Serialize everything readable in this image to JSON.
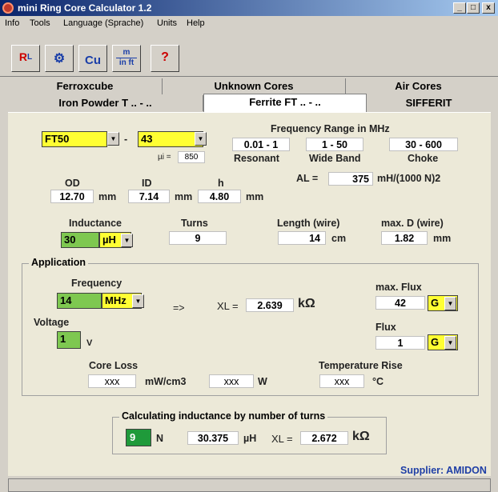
{
  "window": {
    "title": "mini Ring Core Calculator 1.2"
  },
  "menu": [
    "Info",
    "Tools",
    "Language (Sprache)",
    "Units",
    "Help"
  ],
  "toolbar": {
    "btn1": "R",
    "btn1b": "L",
    "btn2": "⚙",
    "btn3": "Cu",
    "btn4a": "m",
    "btn4b": "in ft",
    "btn5": "?"
  },
  "tabs": {
    "row1": [
      "Ferroxcube",
      "Unknown Cores",
      "Air Cores"
    ],
    "row2": [
      "Iron Powder T .. - ..",
      "Ferrite FT .. - ..",
      "SIFFERIT"
    ]
  },
  "core": {
    "type": "FT50",
    "dash": "-",
    "material": "43",
    "mu_label": "µi =",
    "mu": "850"
  },
  "freq_range": {
    "title": "Frequency Range in MHz",
    "resonant_val": "0.01 - 1",
    "wide_val": "1 - 50",
    "choke_val": "30 - 600",
    "resonant": "Resonant",
    "wide": "Wide Band",
    "choke": "Choke"
  },
  "al": {
    "label": "AL =",
    "value": "375",
    "unit": "mH/(1000 N)2"
  },
  "dims": {
    "od_label": "OD",
    "id_label": "ID",
    "h_label": "h",
    "od": "12.70",
    "id": "7.14",
    "h": "4.80",
    "unit": "mm"
  },
  "inductance": {
    "label": "Inductance",
    "value": "30",
    "unit": "µH"
  },
  "turns": {
    "label": "Turns",
    "value": "9"
  },
  "length": {
    "label": "Length (wire)",
    "value": "14",
    "unit": "cm"
  },
  "maxd": {
    "label": "max. D (wire)",
    "value": "1.82",
    "unit": "mm"
  },
  "application": {
    "title": "Application",
    "freq_label": "Frequency",
    "freq": "14",
    "freq_unit": "MHz",
    "arrow": "=>",
    "xl_label": "XL =",
    "xl": "2.639",
    "xl_unit": "kΩ",
    "maxflux_label": "max. Flux",
    "maxflux": "42",
    "maxflux_unit": "G",
    "voltage_label": "Voltage",
    "voltage": "1",
    "voltage_unit": "V",
    "flux_label": "Flux",
    "flux": "1",
    "flux_unit": "G",
    "coreloss_label": "Core Loss",
    "coreloss": "xxx",
    "coreloss_unit": "mW/cm3",
    "w": "xxx",
    "w_unit": "W",
    "temp_label": "Temperature Rise",
    "temp": "xxx",
    "temp_unit": "°C"
  },
  "calc": {
    "title": "Calculating inductance by number of turns",
    "n": "9",
    "n_unit": "N",
    "l": "30.375",
    "l_unit": "µH",
    "xl_label": "XL =",
    "xl": "2.672",
    "xl_unit": "kΩ"
  },
  "supplier": "Supplier: AMIDON"
}
